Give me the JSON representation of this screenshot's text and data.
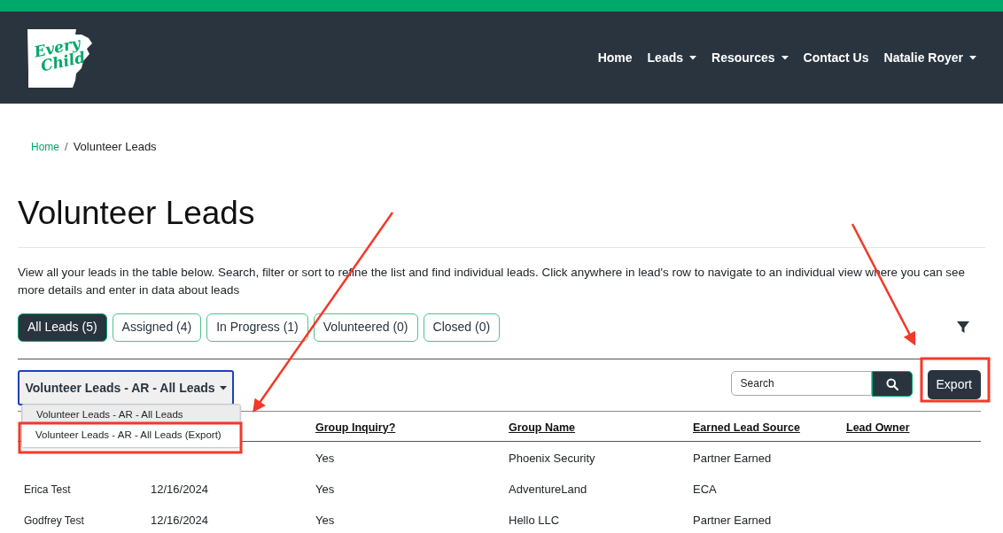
{
  "logo": {
    "lines": [
      "Every",
      "Child"
    ]
  },
  "nav": [
    {
      "label": "Home",
      "dropdown": false
    },
    {
      "label": "Leads",
      "dropdown": true
    },
    {
      "label": "Resources",
      "dropdown": true
    },
    {
      "label": "Contact Us",
      "dropdown": false
    },
    {
      "label": "Natalie Royer",
      "dropdown": true
    }
  ],
  "breadcrumb": [
    {
      "label": "Home",
      "link": true
    },
    {
      "label": "Volunteer Leads",
      "link": false
    }
  ],
  "breadcrumb_separator": "/",
  "title": "Volunteer Leads",
  "description": "View all your leads in the table below. Search, filter or sort to refine the list and find individual leads. Click anywhere in lead's row to navigate to an individual view where you can see more details and enter in data about leads",
  "tabs": [
    {
      "label": "All Leads (5)",
      "selected": true
    },
    {
      "label": "Assigned (4)",
      "selected": false
    },
    {
      "label": "In Progress (1)",
      "selected": false
    },
    {
      "label": "Volunteered (0)",
      "selected": false
    },
    {
      "label": "Closed (0)",
      "selected": false
    }
  ],
  "view_select": {
    "value": "Volunteer Leads - AR - All Leads",
    "expanded": true,
    "options": [
      {
        "label": "Volunteer Leads - AR - All Leads",
        "selected": true
      },
      {
        "label": "Volunteer Leads - AR - All Leads (Export)",
        "selected": false
      }
    ]
  },
  "search": {
    "placeholder": "Search"
  },
  "export_button": "Export",
  "table": {
    "columns": [
      null,
      null,
      "Group Inquiry?",
      "Group Name",
      "Earned Lead Source",
      "Lead Owner"
    ],
    "rows": [
      [
        null,
        null,
        "Yes",
        "Phoenix Security",
        "Partner Earned"
      ],
      [
        "Erica Test",
        "12/16/2024",
        "Yes",
        "AdventureLand",
        "ECA"
      ],
      [
        "Godfrey Test",
        "12/16/2024",
        "Yes",
        "Hello LLC",
        "Partner Earned"
      ]
    ]
  }
}
